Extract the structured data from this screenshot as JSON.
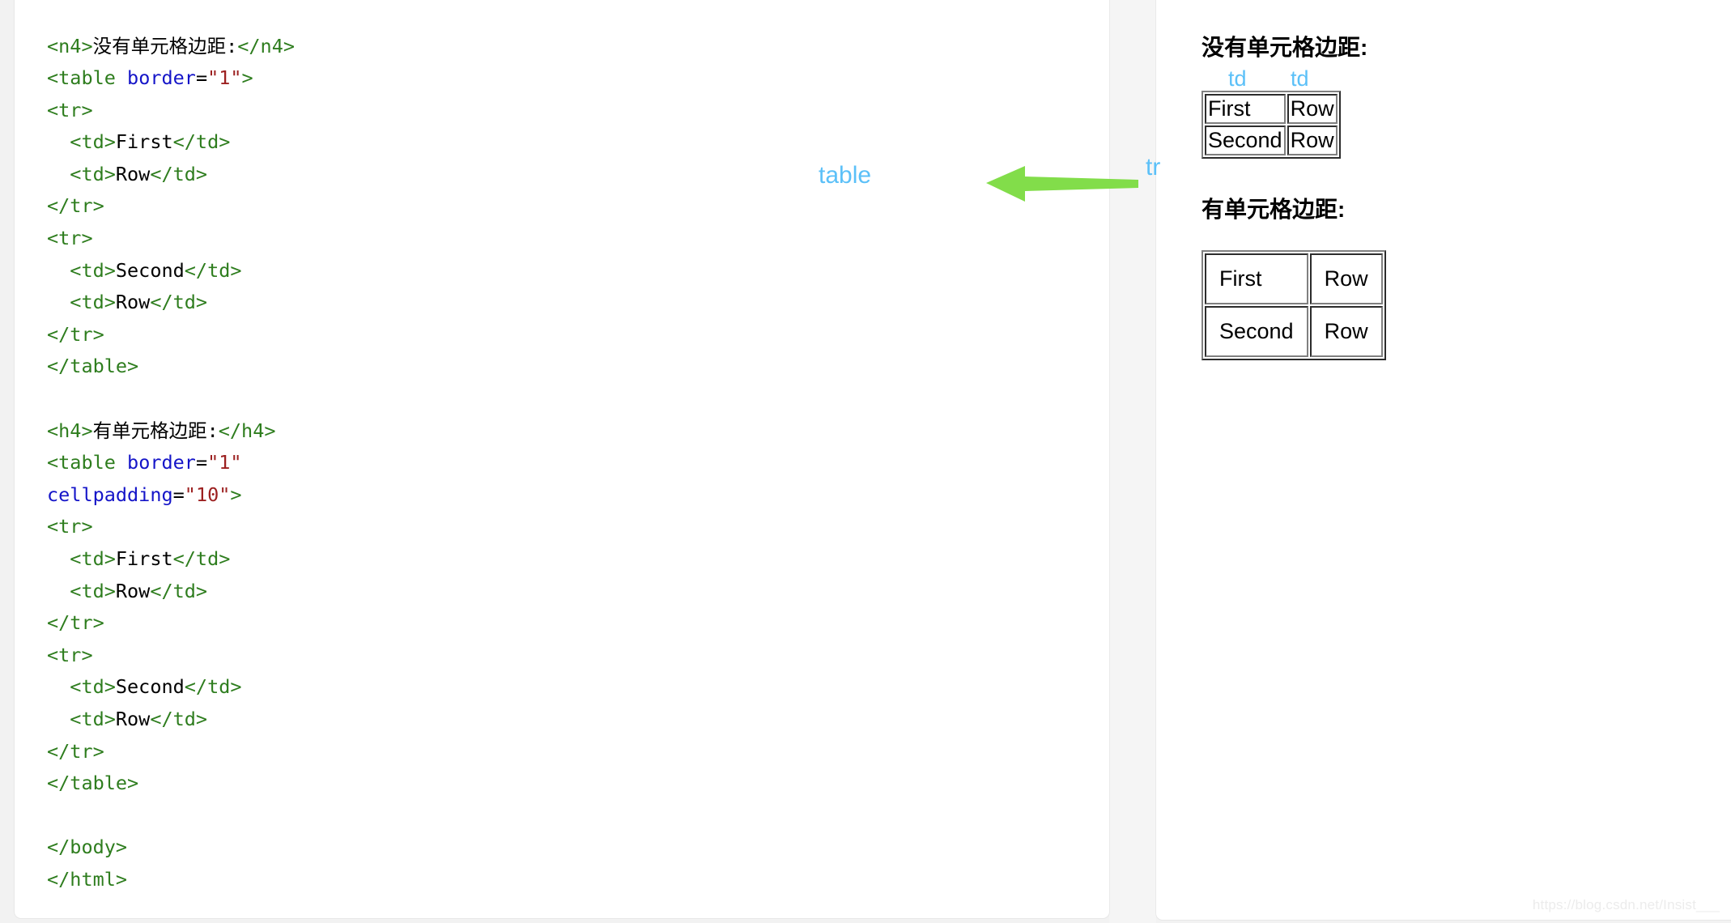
{
  "code_panel": {
    "lines": [
      [
        {
          "t": "tag",
          "v": "<n4>"
        },
        {
          "t": "txt",
          "v": "没有单元格边距:"
        },
        {
          "t": "tag",
          "v": "</n4>"
        }
      ],
      [
        {
          "t": "tag",
          "v": "<table "
        },
        {
          "t": "attr",
          "v": "border"
        },
        {
          "t": "txt",
          "v": "="
        },
        {
          "t": "str",
          "v": "\"1\""
        },
        {
          "t": "tag",
          "v": ">"
        }
      ],
      [
        {
          "t": "tag",
          "v": "<tr>"
        }
      ],
      [
        {
          "t": "tag",
          "v": "  <td>"
        },
        {
          "t": "txt",
          "v": "First"
        },
        {
          "t": "tag",
          "v": "</td>"
        }
      ],
      [
        {
          "t": "tag",
          "v": "  <td>"
        },
        {
          "t": "txt",
          "v": "Row"
        },
        {
          "t": "tag",
          "v": "</td>"
        }
      ],
      [
        {
          "t": "tag",
          "v": "</tr>"
        }
      ],
      [
        {
          "t": "tag",
          "v": "<tr>"
        }
      ],
      [
        {
          "t": "tag",
          "v": "  <td>"
        },
        {
          "t": "txt",
          "v": "Second"
        },
        {
          "t": "tag",
          "v": "</td>"
        }
      ],
      [
        {
          "t": "tag",
          "v": "  <td>"
        },
        {
          "t": "txt",
          "v": "Row"
        },
        {
          "t": "tag",
          "v": "</td>"
        }
      ],
      [
        {
          "t": "tag",
          "v": "</tr>"
        }
      ],
      [
        {
          "t": "tag",
          "v": "</table>"
        }
      ],
      [],
      [
        {
          "t": "tag",
          "v": "<h4>"
        },
        {
          "t": "txt",
          "v": "有单元格边距:"
        },
        {
          "t": "tag",
          "v": "</h4>"
        }
      ],
      [
        {
          "t": "tag",
          "v": "<table "
        },
        {
          "t": "attr",
          "v": "border"
        },
        {
          "t": "txt",
          "v": "="
        },
        {
          "t": "str",
          "v": "\"1\""
        }
      ],
      [
        {
          "t": "attr",
          "v": "cellpadding"
        },
        {
          "t": "txt",
          "v": "="
        },
        {
          "t": "str",
          "v": "\"10\""
        },
        {
          "t": "tag",
          "v": ">"
        }
      ],
      [
        {
          "t": "tag",
          "v": "<tr>"
        }
      ],
      [
        {
          "t": "tag",
          "v": "  <td>"
        },
        {
          "t": "txt",
          "v": "First"
        },
        {
          "t": "tag",
          "v": "</td>"
        }
      ],
      [
        {
          "t": "tag",
          "v": "  <td>"
        },
        {
          "t": "txt",
          "v": "Row"
        },
        {
          "t": "tag",
          "v": "</td>"
        }
      ],
      [
        {
          "t": "tag",
          "v": "</tr>"
        }
      ],
      [
        {
          "t": "tag",
          "v": "<tr>"
        }
      ],
      [
        {
          "t": "tag",
          "v": "  <td>"
        },
        {
          "t": "txt",
          "v": "Second"
        },
        {
          "t": "tag",
          "v": "</td>"
        }
      ],
      [
        {
          "t": "tag",
          "v": "  <td>"
        },
        {
          "t": "txt",
          "v": "Row"
        },
        {
          "t": "tag",
          "v": "</td>"
        }
      ],
      [
        {
          "t": "tag",
          "v": "</tr>"
        }
      ],
      [
        {
          "t": "tag",
          "v": "</table>"
        }
      ],
      [],
      [
        {
          "t": "tag",
          "v": "</body>"
        }
      ],
      [
        {
          "t": "tag",
          "v": "</html>"
        }
      ]
    ]
  },
  "render_panel": {
    "heading_1": "没有单元格边距:",
    "heading_2": "有单元格边距:",
    "td_label_left": "td",
    "td_label_right": "td",
    "table_nopadding": {
      "rows": [
        [
          "First",
          "Row"
        ],
        [
          "Second",
          "Row"
        ]
      ]
    },
    "table_padded": {
      "rows": [
        [
          "First",
          "Row"
        ],
        [
          "Second",
          "Row"
        ]
      ]
    }
  },
  "annotations": {
    "table_label": "table",
    "tr_label": "tr",
    "arrow_icon": "left-arrow-icon",
    "arrow_color": "#82dd4a",
    "label_color": "#5bc0f8"
  },
  "watermark": {
    "text": "https://blog.csdn.net/Insist___"
  },
  "colors": {
    "tag": "#2e7d1e",
    "attribute": "#1414c8",
    "string": "#9c2020",
    "text": "#000000",
    "page_background": "#f2f2f2",
    "panel_background": "#ffffff"
  }
}
